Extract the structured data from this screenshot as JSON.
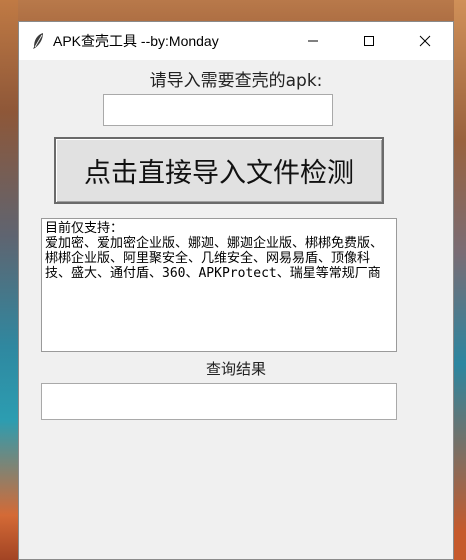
{
  "window": {
    "title": "APK查壳工具 --by:Monday",
    "icon": "feather-icon",
    "controls": {
      "minimize": "minimize-icon",
      "maximize": "maximize-icon",
      "close": "close-icon"
    }
  },
  "main": {
    "prompt_label": "请导入需要查壳的apk:",
    "apk_path_value": "",
    "import_button_label": "点击直接导入文件检测",
    "support_text": "目前仅支持：\n爱加密、爱加密企业版、娜迦、娜迦企业版、梆梆免费版、梆梆企业版、阿里聚安全、几维安全、网易易盾、顶像科技、盛大、通付盾、360、APKProtect、瑞星等常规厂商",
    "result_label": "查询结果",
    "result_value": ""
  }
}
